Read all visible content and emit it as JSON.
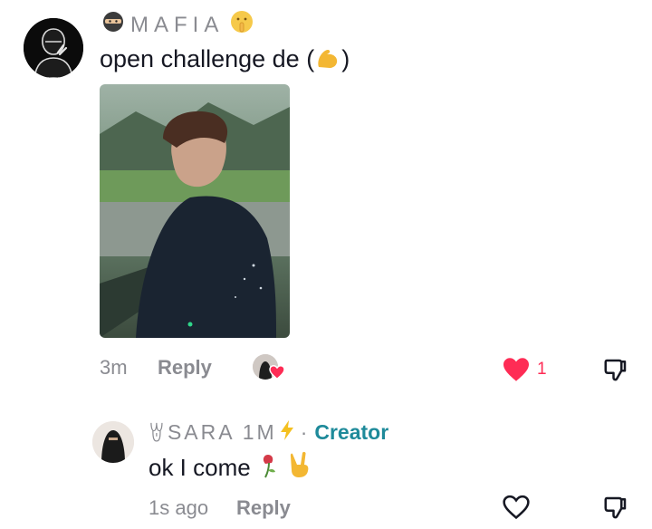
{
  "comment": {
    "username": "MAFIA",
    "text": "open challenge de (",
    "text_close": ")",
    "time": "3m",
    "reply_label": "Reply",
    "like_count": "1"
  },
  "reply": {
    "username_prefix": "ꇐ",
    "username": "SARA 1M",
    "separator": "·",
    "badge": "Creator",
    "text": "ok I come",
    "time": "1s ago",
    "reply_label": "Reply"
  },
  "icons": {
    "ninja": "ninja-emoji",
    "shush": "shushing-face-emoji",
    "bolt": "high-voltage-emoji",
    "flex": "flexed-biceps-emoji",
    "rose": "wilted-rose-emoji",
    "victory": "victory-hand-emoji",
    "heart_filled": "heart-filled-icon",
    "heart_outline": "heart-outline-icon",
    "dislike": "thumbs-down-icon"
  },
  "colors": {
    "like_red": "#fe2c55",
    "creator_teal": "#1e8a9a",
    "muted_gray": "#8a8b91"
  }
}
